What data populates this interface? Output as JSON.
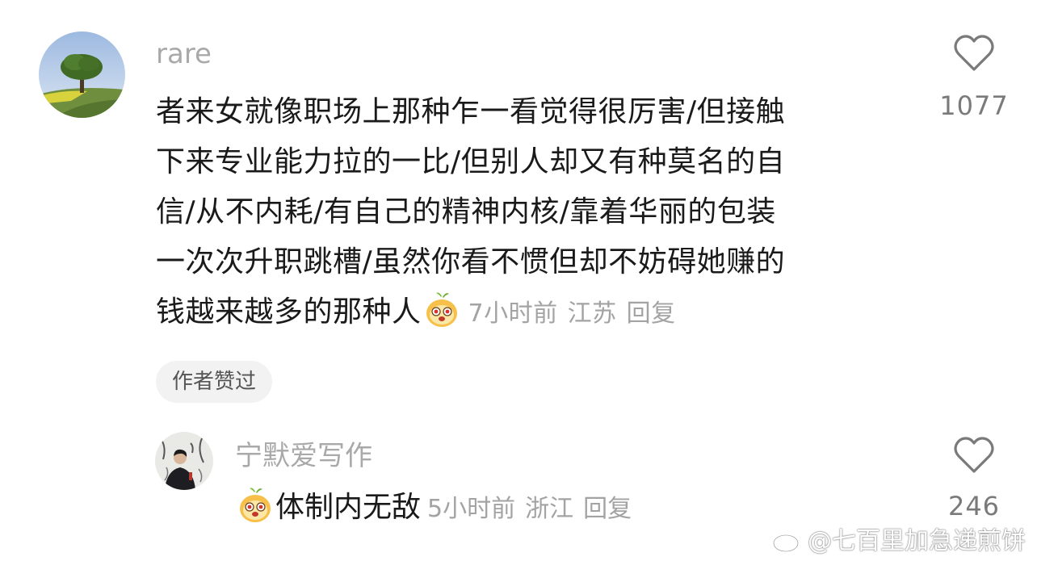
{
  "main_comment": {
    "username": "rare",
    "lines": [
      "者来女就像职场上那种乍一看觉得很厉害/但接触",
      "下来专业能力拉的一比/但别人却又有种莫名的自",
      "信/从不内耗/有自己的精神内核/靠着华丽的包装",
      "一次次升职跳槽/虽然你看不惯但却不妨碍她赚的",
      "钱越来越多的那种人"
    ],
    "emoji": "smiling-face-emoji",
    "time": "7小时前",
    "location": "江苏",
    "reply_label": "回复",
    "author_liked": "作者赞过",
    "like_count": "1077"
  },
  "reply_comment": {
    "username": "宁默爱写作",
    "emoji": "smiling-face-emoji",
    "text": "体制内无敌",
    "time": "5小时前",
    "location": "浙江",
    "reply_label": "回复",
    "like_count": "246"
  },
  "watermark": {
    "text": "@七百里加急递煎饼",
    "icon": "weibo-icon"
  },
  "colors": {
    "text": "#1a1a1a",
    "meta": "#a3a3a3",
    "username": "#a9a9a9",
    "tag_bg": "#f2f2f2"
  }
}
